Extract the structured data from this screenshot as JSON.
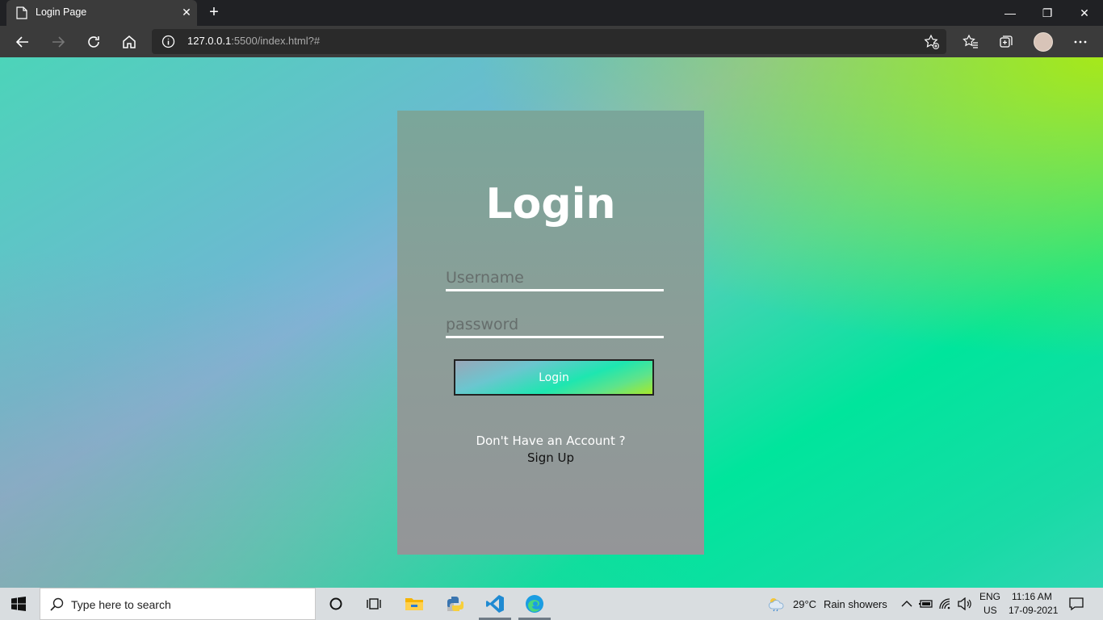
{
  "browser": {
    "tab_title": "Login Page",
    "url_host": "127.0.0.1",
    "url_rest": ":5500/index.html?#"
  },
  "page": {
    "title": "Login",
    "username_placeholder": "Username",
    "password_placeholder": "password",
    "login_button": "Login",
    "question": "Don't Have an Account ?",
    "signup": "Sign Up"
  },
  "taskbar": {
    "search_placeholder": "Type here to search",
    "weather_temp": "29°C",
    "weather_desc": "Rain showers",
    "lang_top": "ENG",
    "lang_bottom": "US",
    "time": "11:16 AM",
    "date": "17-09-2021"
  }
}
